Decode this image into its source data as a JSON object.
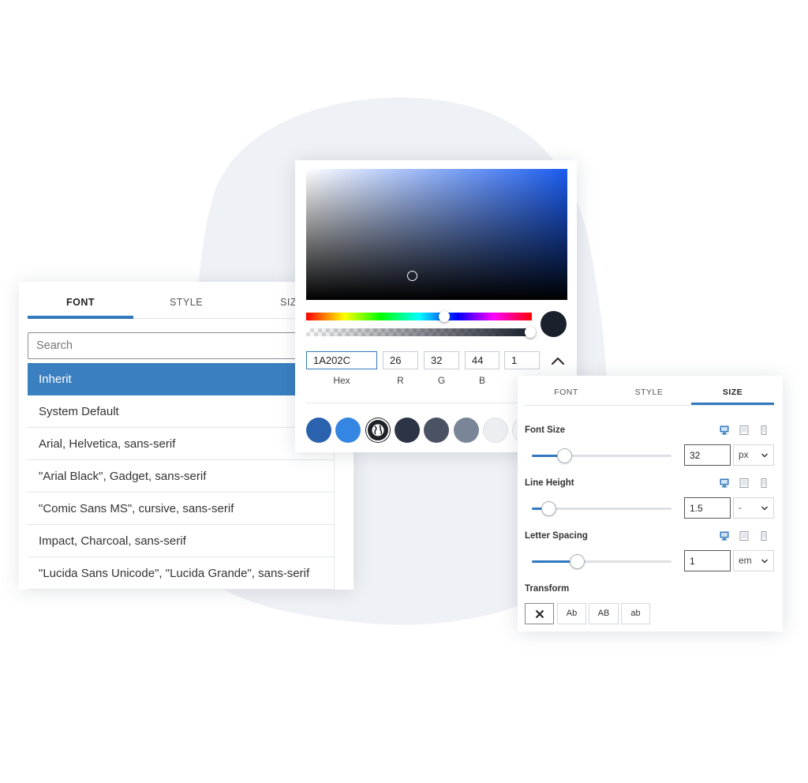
{
  "font_panel": {
    "tabs": [
      {
        "label": "FONT",
        "active": true
      },
      {
        "label": "STYLE",
        "active": false
      },
      {
        "label": "SIZE",
        "active": false
      }
    ],
    "search_placeholder": "Search",
    "fonts": [
      {
        "label": "Inherit",
        "selected": true
      },
      {
        "label": "System Default",
        "selected": false
      },
      {
        "label": "Arial, Helvetica, sans-serif",
        "selected": false
      },
      {
        "label": "\"Arial Black\", Gadget, sans-serif",
        "selected": false
      },
      {
        "label": "\"Comic Sans MS\", cursive, sans-serif",
        "selected": false
      },
      {
        "label": "Impact, Charcoal, sans-serif",
        "selected": false
      },
      {
        "label": "\"Lucida Sans Unicode\", \"Lucida Grande\", sans-serif",
        "selected": false
      }
    ]
  },
  "color_picker": {
    "hex": "1A202C",
    "r": "26",
    "g": "32",
    "b": "44",
    "a": "1",
    "labels": {
      "hex": "Hex",
      "r": "R",
      "g": "G",
      "b": "B"
    },
    "preview_color": "#1a202c",
    "swatches": [
      {
        "color": "#2b62ad",
        "icon": null
      },
      {
        "color": "#3585e3",
        "icon": null
      },
      {
        "color": "#1f2227",
        "icon": "globe-icon"
      },
      {
        "color": "#2d3446",
        "icon": null
      },
      {
        "color": "#4b5263",
        "icon": null
      },
      {
        "color": "#7a8598",
        "icon": null
      },
      {
        "color": "#eceef1",
        "icon": null
      },
      {
        "color": "#f7f8f9",
        "icon": null
      }
    ]
  },
  "size_panel": {
    "tabs": [
      {
        "label": "FONT",
        "active": false
      },
      {
        "label": "STYLE",
        "active": false
      },
      {
        "label": "SIZE",
        "active": true
      }
    ],
    "font_size": {
      "label": "Font Size",
      "value": "32",
      "unit": "px",
      "slider_fraction": 0.23
    },
    "line_height": {
      "label": "Line Height",
      "value": "1.5",
      "unit": "-",
      "slider_fraction": 0.12
    },
    "letter_spacing": {
      "label": "Letter Spacing",
      "value": "1",
      "unit": "em",
      "slider_fraction": 0.32
    },
    "transform": {
      "label": "Transform",
      "options": [
        {
          "label": "",
          "icon": "clear-icon",
          "active": true
        },
        {
          "label": "Ab",
          "active": false
        },
        {
          "label": "AB",
          "active": false
        },
        {
          "label": "ab",
          "active": false
        }
      ]
    }
  },
  "colors": {
    "accent": "#3079be",
    "selected_row": "#3a7fc0",
    "blob": "#eef1f5"
  }
}
